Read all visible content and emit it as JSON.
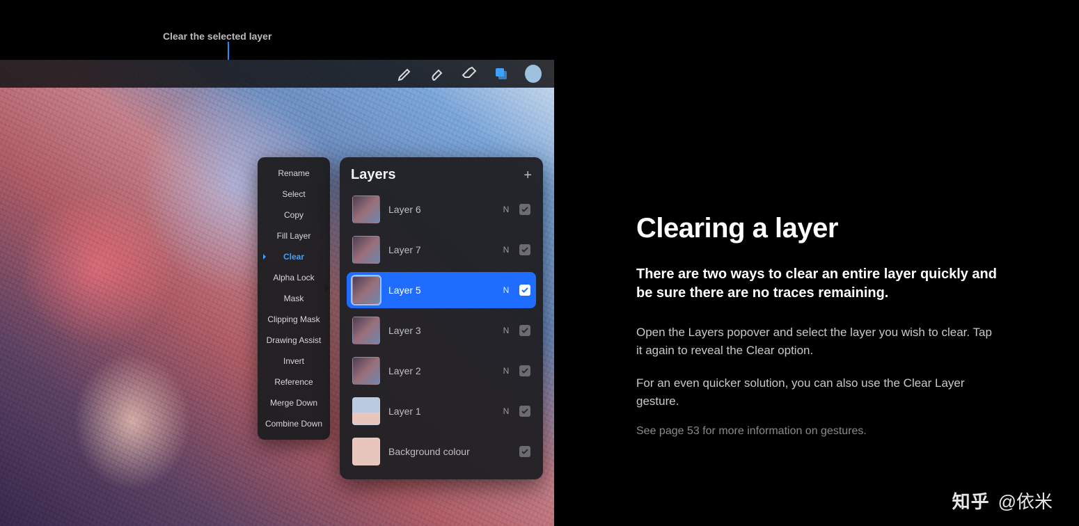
{
  "annotation": {
    "label": "Clear the selected layer"
  },
  "toolbar": {
    "icons": [
      "brush-icon",
      "smudge-icon",
      "eraser-icon",
      "layers-icon",
      "color-icon"
    ]
  },
  "context_menu": {
    "items": [
      {
        "label": "Rename"
      },
      {
        "label": "Select"
      },
      {
        "label": "Copy"
      },
      {
        "label": "Fill Layer"
      },
      {
        "label": "Clear",
        "highlight": true
      },
      {
        "label": "Alpha Lock"
      },
      {
        "label": "Mask"
      },
      {
        "label": "Clipping Mask"
      },
      {
        "label": "Drawing Assist"
      },
      {
        "label": "Invert"
      },
      {
        "label": "Reference"
      },
      {
        "label": "Merge Down"
      },
      {
        "label": "Combine Down"
      }
    ]
  },
  "layers_panel": {
    "title": "Layers",
    "rows": [
      {
        "name": "Layer 6",
        "blend": "N",
        "checked": true
      },
      {
        "name": "Layer 7",
        "blend": "N",
        "checked": true
      },
      {
        "name": "Layer 5",
        "blend": "N",
        "checked": true,
        "selected": true
      },
      {
        "name": "Layer 3",
        "blend": "N",
        "checked": true
      },
      {
        "name": "Layer 2",
        "blend": "N",
        "checked": true
      },
      {
        "name": "Layer 1",
        "blend": "N",
        "checked": true
      }
    ],
    "background": {
      "name": "Background colour",
      "checked": true
    }
  },
  "doc": {
    "title": "Clearing a layer",
    "lead": "There are two ways to clear an entire layer quickly and be sure there are no traces remaining.",
    "para1": "Open the Layers popover and select the layer you wish to clear. Tap it again to reveal the Clear option.",
    "para2": "For an even quicker solution, you can also use the Clear Layer gesture.",
    "note": "See page 53 for more information on gestures."
  },
  "watermark": {
    "brand": "知乎",
    "author": "@依米"
  }
}
